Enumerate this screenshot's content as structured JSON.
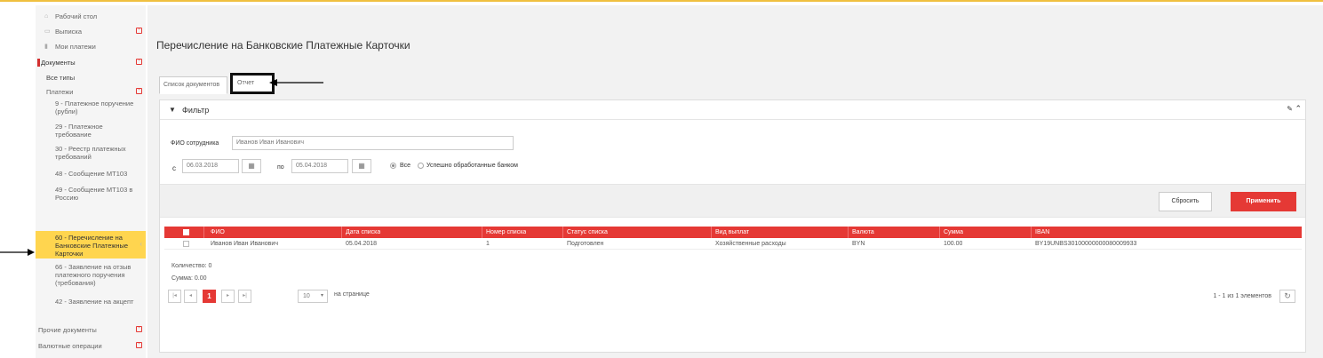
{
  "sidebar": {
    "items": [
      {
        "label": "Рабочий стол"
      },
      {
        "label": "Выписка"
      },
      {
        "label": "Мои платежи"
      },
      {
        "label": "Документы"
      },
      {
        "label": "Все типы"
      },
      {
        "label": "Платежи"
      },
      {
        "label": "9 - Платежное поручение (рубли)"
      },
      {
        "label": "29 - Платежное требование"
      },
      {
        "label": "30 - Реестр платежных требований"
      },
      {
        "label": "48 - Сообщение MT103"
      },
      {
        "label": "49 - Сообщение MT103 в Россию"
      },
      {
        "label": "60 - Перечисление на Банковские Платежные Карточки"
      },
      {
        "label": "66 - Заявление на отзыв платежного поручения (требования)"
      },
      {
        "label": "42 - Заявление на акцепт"
      },
      {
        "label": "Прочие документы"
      },
      {
        "label": "Валютные операции"
      }
    ]
  },
  "page": {
    "title": "Перечисление на Банковские Платежные Карточки"
  },
  "tabs": {
    "list": "Список документов",
    "report": "Отчет"
  },
  "filter": {
    "title": "Фильтр",
    "fio_label": "ФИО сотрудника",
    "fio_value": "Иванов Иван Иванович",
    "from_label": "с",
    "from_value": "06.03.2018",
    "to_label": "по",
    "to_value": "05.04.2018",
    "radio_all": "Все",
    "radio_ok": "Успешно обработанные банком",
    "reset": "Сбросить",
    "apply": "Применить"
  },
  "table": {
    "headers": {
      "fio": "ФИО",
      "date": "Дата списка",
      "number": "Номер списка",
      "status": "Статус списка",
      "type": "Вид выплат",
      "currency": "Валюта",
      "sum": "Сумма",
      "iban": "IBAN"
    },
    "rows": [
      {
        "fio": "Иванов Иван Иванович",
        "date": "05.04.2018",
        "number": "1",
        "status": "Подготовлен",
        "type": "Хозяйственные расходы",
        "currency": "BYN",
        "sum": "100.00",
        "iban": "BY19UNBS30100000000080009933"
      }
    ]
  },
  "summary": {
    "count": "Количество: 0",
    "sum": "Сумма: 0.00"
  },
  "pager": {
    "current": "1",
    "per_page": "10",
    "per_page_label": "на странице",
    "range": "1 - 1 из 1 элементов"
  },
  "colors": {
    "accent": "#e53935",
    "active_item": "#ffd54f"
  }
}
